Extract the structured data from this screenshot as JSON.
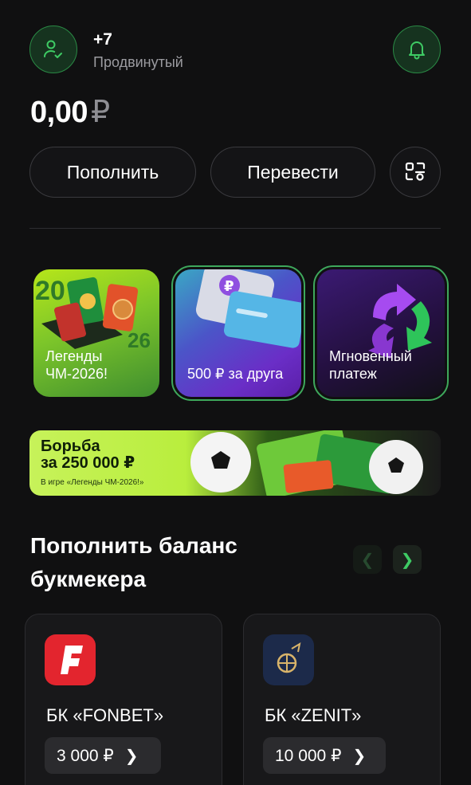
{
  "user": {
    "phone": "+7",
    "level": "Продвинутый"
  },
  "balance": {
    "amount": "0,00",
    "currency": "₽"
  },
  "actions": {
    "topup_label": "Пополнить",
    "transfer_label": "Перевести",
    "qr_icon": "qr-scan-icon"
  },
  "stories": [
    {
      "label": "Легенды ЧМ-2026!"
    },
    {
      "label": "500 ₽ за друга"
    },
    {
      "label": "Мгновенный платеж"
    }
  ],
  "banner": {
    "title_line1": "Борьба",
    "title_line2": "за 250 000 ₽",
    "subtitle": "В игре «Легенды ЧМ-2026!»"
  },
  "bookmakers": {
    "title": "Пополнить баланс букмекера",
    "items": [
      {
        "name": "БК «FONBET»",
        "amount": "3 000 ₽",
        "logo_color": "#e3252e"
      },
      {
        "name": "БК «ZENIT»",
        "amount": "10 000 ₽",
        "logo_color": "#1c2a4a"
      }
    ]
  },
  "colors": {
    "accent": "#3ecb64",
    "background": "#101011"
  }
}
